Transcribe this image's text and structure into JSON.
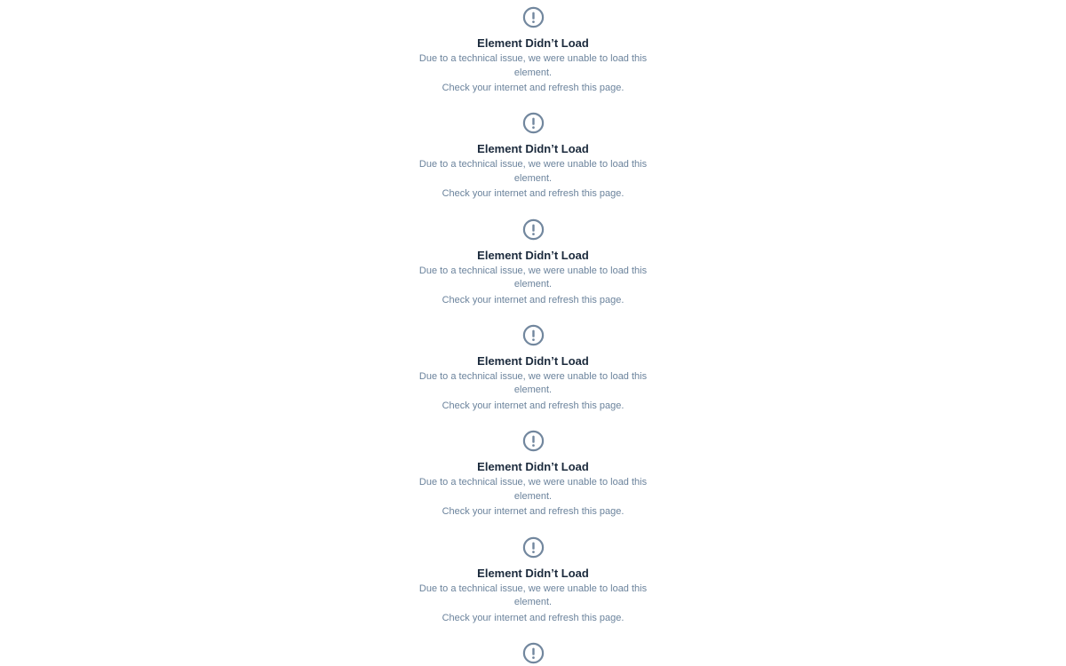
{
  "colors": {
    "icon": "#72879e",
    "title": "#1b2a3c",
    "text": "#6b839c",
    "background": "#ffffff"
  },
  "error_blocks": [
    {
      "icon": "exclamation-circle-icon",
      "title": "Element Didn’t Load",
      "description": "Due to a technical issue, we were unable to load this element.",
      "hint": "Check your internet and refresh this page."
    },
    {
      "icon": "exclamation-circle-icon",
      "title": "Element Didn’t Load",
      "description": "Due to a technical issue, we were unable to load this element.",
      "hint": "Check your internet and refresh this page."
    },
    {
      "icon": "exclamation-circle-icon",
      "title": "Element Didn’t Load",
      "description": "Due to a technical issue, we were unable to load this element.",
      "hint": "Check your internet and refresh this page."
    },
    {
      "icon": "exclamation-circle-icon",
      "title": "Element Didn’t Load",
      "description": "Due to a technical issue, we were unable to load this element.",
      "hint": "Check your internet and refresh this page."
    },
    {
      "icon": "exclamation-circle-icon",
      "title": "Element Didn’t Load",
      "description": "Due to a technical issue, we were unable to load this element.",
      "hint": "Check your internet and refresh this page."
    },
    {
      "icon": "exclamation-circle-icon",
      "title": "Element Didn’t Load",
      "description": "Due to a technical issue, we were unable to load this element.",
      "hint": "Check your internet and refresh this page."
    },
    {
      "icon": "exclamation-circle-icon",
      "title": "",
      "description": "",
      "hint": ""
    }
  ]
}
